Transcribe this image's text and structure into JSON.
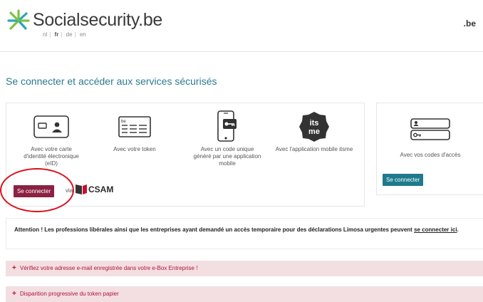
{
  "header": {
    "brand": "Socialsecurity.be",
    "languages": [
      "nl",
      "fr",
      "de",
      "en"
    ],
    "active_language": "fr",
    "country_badge": ".be"
  },
  "page_title": "Se connecter et accéder aux services sécurisés",
  "methods": [
    {
      "label": "Avec votre carte d'identité électronique (eID)",
      "icon": "eid-card-icon"
    },
    {
      "label": "Avec votre token",
      "icon": "token-card-icon"
    },
    {
      "label": "Avec un code unique généré par une application mobile",
      "icon": "mobile-code-icon"
    },
    {
      "label": "Avec l'application mobile itsme",
      "icon": "itsme-icon"
    }
  ],
  "main_panel": {
    "connect_label": "Se connecter",
    "via_label": "via",
    "csam_label": "CSAM"
  },
  "codes_panel": {
    "label": "Avec vos codes d'accès",
    "connect_label": "Se connecter",
    "icon": "login-codes-icon"
  },
  "notice": {
    "text": "Attention ! Les professions libérales ainsi que les entreprises ayant demandé un accès temporaire pour des déclarations Limosa urgentes peuvent ",
    "link": "se connecter ici",
    "tail": "."
  },
  "accordions": [
    {
      "label": "Vérifiez votre adresse e-mail enregistrée dans votre e-Box Entreprise !",
      "icon": "+"
    },
    {
      "label": "Disparition progressive du token papier",
      "icon": "+"
    }
  ],
  "colors": {
    "brand_title": "#2c7a8c",
    "primary_button": "#8b2243",
    "teal_button": "#1e7a8c",
    "accordion_bg": "#f3dfe1",
    "accordion_text": "#b0133d",
    "annotation": "#d9121c"
  }
}
